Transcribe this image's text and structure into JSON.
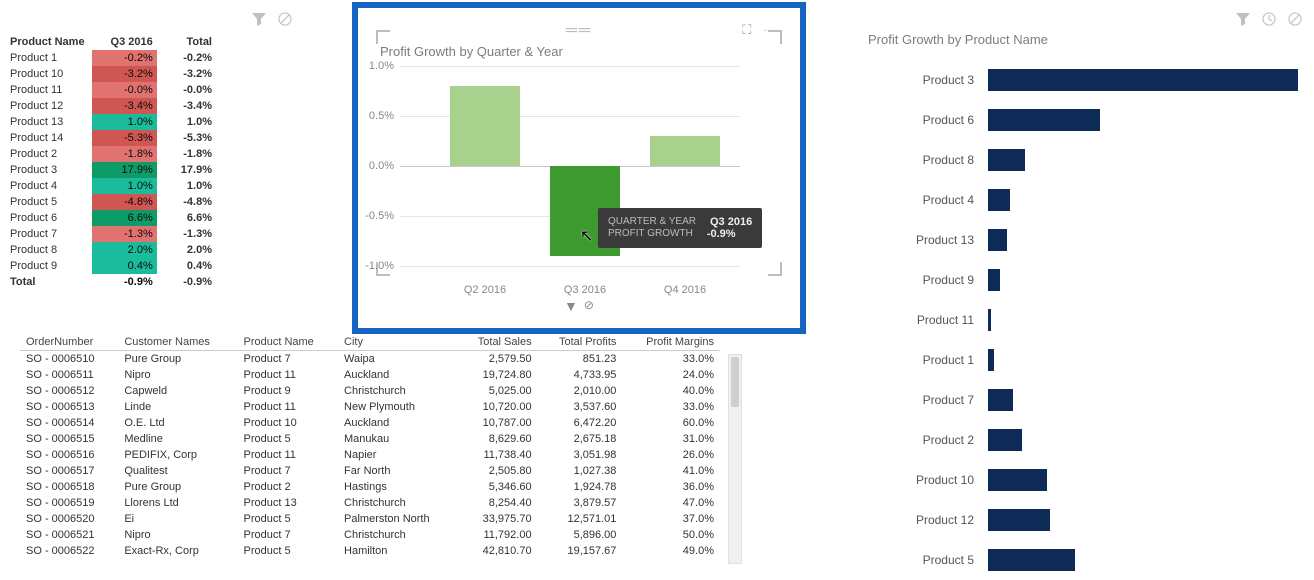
{
  "toolbar_icons": {
    "filter": "funnel-icon",
    "prohibit": "prohibit-icon",
    "clock": "clock-icon"
  },
  "matrix": {
    "headers": {
      "name": "Product Name",
      "q3": "Q3 2016",
      "total": "Total"
    },
    "rows": [
      {
        "name": "Product 1",
        "q3": "-0.2%",
        "total": "-0.2%",
        "cls": "cell-red"
      },
      {
        "name": "Product 10",
        "q3": "-3.2%",
        "total": "-3.2%",
        "cls": "cell-dred"
      },
      {
        "name": "Product 11",
        "q3": "-0.0%",
        "total": "-0.0%",
        "cls": "cell-red"
      },
      {
        "name": "Product 12",
        "q3": "-3.4%",
        "total": "-3.4%",
        "cls": "cell-dred"
      },
      {
        "name": "Product 13",
        "q3": "1.0%",
        "total": "1.0%",
        "cls": "cell-green"
      },
      {
        "name": "Product 14",
        "q3": "-5.3%",
        "total": "-5.3%",
        "cls": "cell-dred"
      },
      {
        "name": "Product 2",
        "q3": "-1.8%",
        "total": "-1.8%",
        "cls": "cell-red"
      },
      {
        "name": "Product 3",
        "q3": "17.9%",
        "total": "17.9%",
        "cls": "cell-dgreen"
      },
      {
        "name": "Product 4",
        "q3": "1.0%",
        "total": "1.0%",
        "cls": "cell-green"
      },
      {
        "name": "Product 5",
        "q3": "-4.8%",
        "total": "-4.8%",
        "cls": "cell-dred"
      },
      {
        "name": "Product 6",
        "q3": "6.6%",
        "total": "6.6%",
        "cls": "cell-dgreen"
      },
      {
        "name": "Product 7",
        "q3": "-1.3%",
        "total": "-1.3%",
        "cls": "cell-red"
      },
      {
        "name": "Product 8",
        "q3": "2.0%",
        "total": "2.0%",
        "cls": "cell-green"
      },
      {
        "name": "Product 9",
        "q3": "0.4%",
        "total": "0.4%",
        "cls": "cell-green"
      }
    ],
    "total_row": {
      "name": "Total",
      "q3": "-0.9%",
      "total": "-0.9%"
    }
  },
  "chart": {
    "title": "Profit Growth by Quarter & Year",
    "yticks": [
      "1.0%",
      "0.5%",
      "0.0%",
      "-0.5%",
      "-1.0%"
    ],
    "xticks": [
      "Q2 2016",
      "Q3 2016",
      "Q4 2016"
    ],
    "tooltip": {
      "k1": "QUARTER & YEAR",
      "v1": "Q3 2016",
      "k2": "PROFIT GROWTH",
      "v2": "-0.9%"
    }
  },
  "chart_data": {
    "type": "bar",
    "title": "Profit Growth by Quarter & Year",
    "categories": [
      "Q2 2016",
      "Q3 2016",
      "Q4 2016"
    ],
    "values": [
      0.8,
      -0.9,
      0.3
    ],
    "ylabel": "Profit Growth",
    "ylim": [
      -1.0,
      1.0
    ],
    "highlighted_index": 1
  },
  "orders": {
    "headers": [
      "OrderNumber",
      "Customer Names",
      "Product Name",
      "City",
      "Total Sales",
      "Total Profits",
      "Profit Margins"
    ],
    "rows": [
      [
        "SO - 0006510",
        "Pure Group",
        "Product 7",
        "Waipa",
        "2,579.50",
        "851.23",
        "33.0%"
      ],
      [
        "SO - 0006511",
        "Nipro",
        "Product 11",
        "Auckland",
        "19,724.80",
        "4,733.95",
        "24.0%"
      ],
      [
        "SO - 0006512",
        "Capweld",
        "Product 9",
        "Christchurch",
        "5,025.00",
        "2,010.00",
        "40.0%"
      ],
      [
        "SO - 0006513",
        "Linde",
        "Product 11",
        "New Plymouth",
        "10,720.00",
        "3,537.60",
        "33.0%"
      ],
      [
        "SO - 0006514",
        "O.E. Ltd",
        "Product 10",
        "Auckland",
        "10,787.00",
        "6,472.20",
        "60.0%"
      ],
      [
        "SO - 0006515",
        "Medline",
        "Product 5",
        "Manukau",
        "8,629.60",
        "2,675.18",
        "31.0%"
      ],
      [
        "SO - 0006516",
        "PEDIFIX, Corp",
        "Product 11",
        "Napier",
        "11,738.40",
        "3,051.98",
        "26.0%"
      ],
      [
        "SO - 0006517",
        "Qualitest",
        "Product 7",
        "Far North",
        "2,505.80",
        "1,027.38",
        "41.0%"
      ],
      [
        "SO - 0006518",
        "Pure Group",
        "Product 2",
        "Hastings",
        "5,346.60",
        "1,924.78",
        "36.0%"
      ],
      [
        "SO - 0006519",
        "Llorens Ltd",
        "Product 13",
        "Christchurch",
        "8,254.40",
        "3,879.57",
        "47.0%"
      ],
      [
        "SO - 0006520",
        "Ei",
        "Product 5",
        "Palmerston North",
        "33,975.70",
        "12,571.01",
        "37.0%"
      ],
      [
        "SO - 0006521",
        "Nipro",
        "Product 7",
        "Christchurch",
        "11,792.00",
        "5,896.00",
        "50.0%"
      ],
      [
        "SO - 0006522",
        "Exact-Rx, Corp",
        "Product 5",
        "Hamilton",
        "42,810.70",
        "19,157.67",
        "49.0%"
      ]
    ]
  },
  "rbars": {
    "title": "Profit Growth by Product Name",
    "rows": [
      {
        "label": "Product 3",
        "pct": 100
      },
      {
        "label": "Product 6",
        "pct": 36
      },
      {
        "label": "Product 8",
        "pct": 12
      },
      {
        "label": "Product 4",
        "pct": 7
      },
      {
        "label": "Product 13",
        "pct": 6
      },
      {
        "label": "Product 9",
        "pct": 4
      },
      {
        "label": "Product 11",
        "pct": 1
      },
      {
        "label": "Product 1",
        "pct": 2
      },
      {
        "label": "Product 7",
        "pct": 8
      },
      {
        "label": "Product 2",
        "pct": 11
      },
      {
        "label": "Product 10",
        "pct": 19
      },
      {
        "label": "Product 12",
        "pct": 20
      },
      {
        "label": "Product 5",
        "pct": 28
      }
    ]
  }
}
